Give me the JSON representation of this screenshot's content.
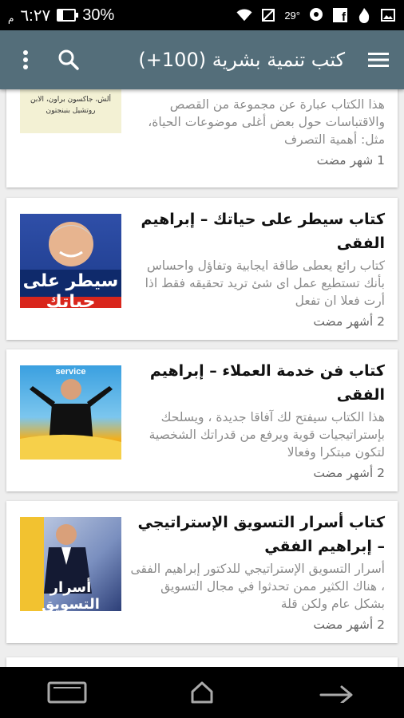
{
  "status_bar": {
    "time": "٦:٢٧",
    "ampm": "م",
    "battery": "30%",
    "battery_level": 0.3,
    "temperature": "29°"
  },
  "app_bar": {
    "title": "كتب تنمية بشرية (100+)"
  },
  "articles": [
    {
      "title": "",
      "snippet": "هذا الكتاب عبارة عن مجموعة من القصص والاقتباسات حول بعض أغلى موضوعات الحياة، مثل: أهمية التصرف",
      "time": "1 شهر مضت",
      "thumb_text": "ألش، جاكسون براون، الابن روتشيل بنبنجتون"
    },
    {
      "title": "كتاب سيطر على حياتك – إبراهيم الفقى",
      "snippet": "كتاب رائع يعطى طاقة ايجابية وتفاؤل واحساس بأنك تستطيع عمل اى شئ تريد تحقيقه فقط اذا أرت فعلا ان تفعل",
      "time": "2 أشهر مضت",
      "thumb_text": "سيطر على حياتك"
    },
    {
      "title": "كتاب فن خدمة العملاء – إبراهيم الفقى",
      "snippet": "هذا الكتاب سيفتح لك آفاقا جديدة ، ويسلحك بإستراتيجيات قوية ويرفع من قدراتك الشخصية لتكون مبتكرا وفعالا",
      "time": "2 أشهر مضت",
      "thumb_text": "service"
    },
    {
      "title": "كتاب أسرار التسويق الإستراتيجي – إبراهيم الفقي",
      "snippet": "أسرار التسويق الإستراتيجي للدكتور إبراهيم الفقى ، هناك الكثير ممن تحدثوا في مجال التسويق بشكل عام ولكن قلة",
      "time": "2 أشهر مضت",
      "thumb_text": "أسرار التسويق"
    }
  ],
  "icons": {
    "menu": "hamburger-icon",
    "search": "search-icon",
    "overflow": "more-vert-icon",
    "recents": "recent-apps-icon",
    "home": "home-icon",
    "back": "back-icon"
  },
  "colors": {
    "app_bar": "#546e7a",
    "status_bar": "#000000",
    "card_bg": "#ffffff",
    "page_bg": "#eeeeee"
  }
}
